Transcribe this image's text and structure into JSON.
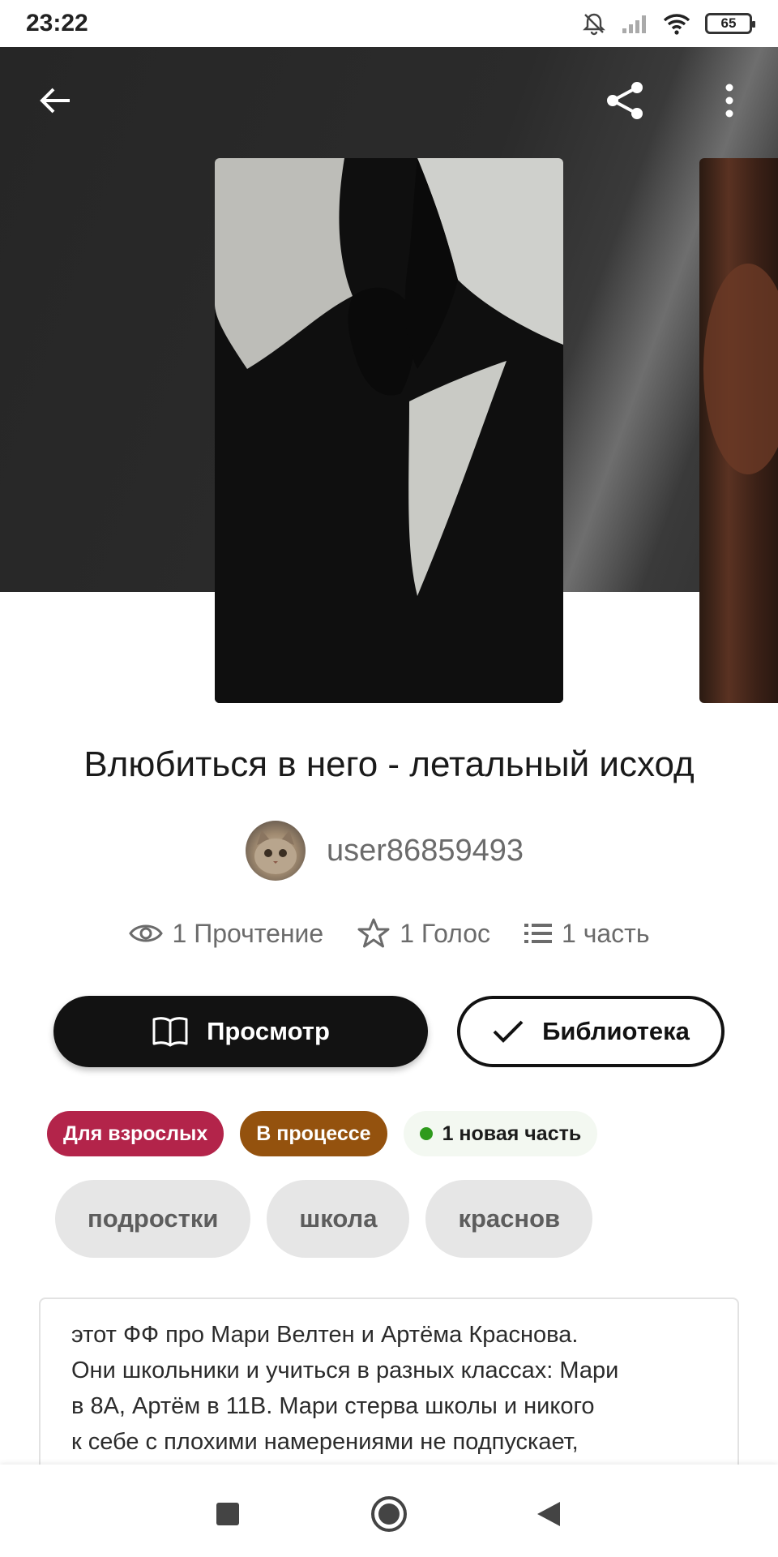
{
  "status_bar": {
    "time": "23:22",
    "battery": "65"
  },
  "story": {
    "title": "Влюбиться в него - летальный исход",
    "author": "user86859493",
    "stats": {
      "reads": "1 Прочтение",
      "votes": "1 Голос",
      "parts": "1 часть"
    }
  },
  "actions": {
    "view_label": "Просмотр",
    "library_label": "Библиотека"
  },
  "badges": {
    "mature": "Для взрослых",
    "status": "В процессе",
    "new_parts": "1 новая часть"
  },
  "tags": [
    "подростки",
    "школа",
    "краснов"
  ],
  "description": {
    "lines": [
      "этот ФФ про Мари Велтен и Артёма Краснова.",
      "Они школьники и учиться в разных классах: Мари",
      "в 8А, Артём в 11В. Мари стерва школы и никого",
      "к себе с плохими намерениями не подпускает,"
    ]
  },
  "colors": {
    "badge_mature": "#b3244a",
    "badge_progress": "#94520e",
    "new_dot": "#2e9a1c",
    "primary_button": "#121212"
  },
  "icons": [
    "back-arrow-icon",
    "share-icon",
    "more-vert-icon",
    "eye-icon",
    "star-icon",
    "list-icon",
    "book-open-icon",
    "check-icon"
  ]
}
